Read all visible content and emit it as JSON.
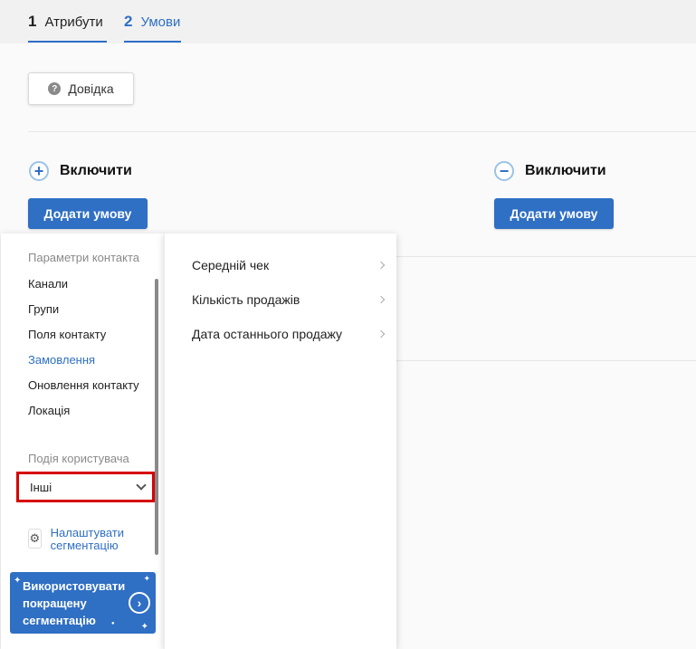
{
  "tabs": [
    {
      "num": "1",
      "label": "Атрибути"
    },
    {
      "num": "2",
      "label": "Умови"
    }
  ],
  "help_button": {
    "label": "Довідка",
    "icon": "question-circle-icon"
  },
  "include": {
    "title": "Включити",
    "add_label": "Додати умову",
    "icon": "plus-circle-icon"
  },
  "exclude": {
    "title": "Виключити",
    "add_label": "Додати умову",
    "icon": "minus-circle-icon"
  },
  "menu": {
    "contact_params_title": "Параметри контакта",
    "contact_items": [
      "Канали",
      "Групи",
      "Поля контакту",
      "Замовлення",
      "Оновлення контакту",
      "Локація"
    ],
    "active_item": "Замовлення",
    "user_event_title": "Подія користувача",
    "user_event_select": "Інші",
    "settings_link": "Налаштувати сегментацію",
    "promo_text": "Використовувати покращену сегментацію",
    "submenu_items": [
      "Середній чек",
      "Кількість продажів",
      "Дата останнього продажу"
    ]
  },
  "colors": {
    "accent": "#2f6fc4",
    "highlight_border": "#d60000"
  }
}
